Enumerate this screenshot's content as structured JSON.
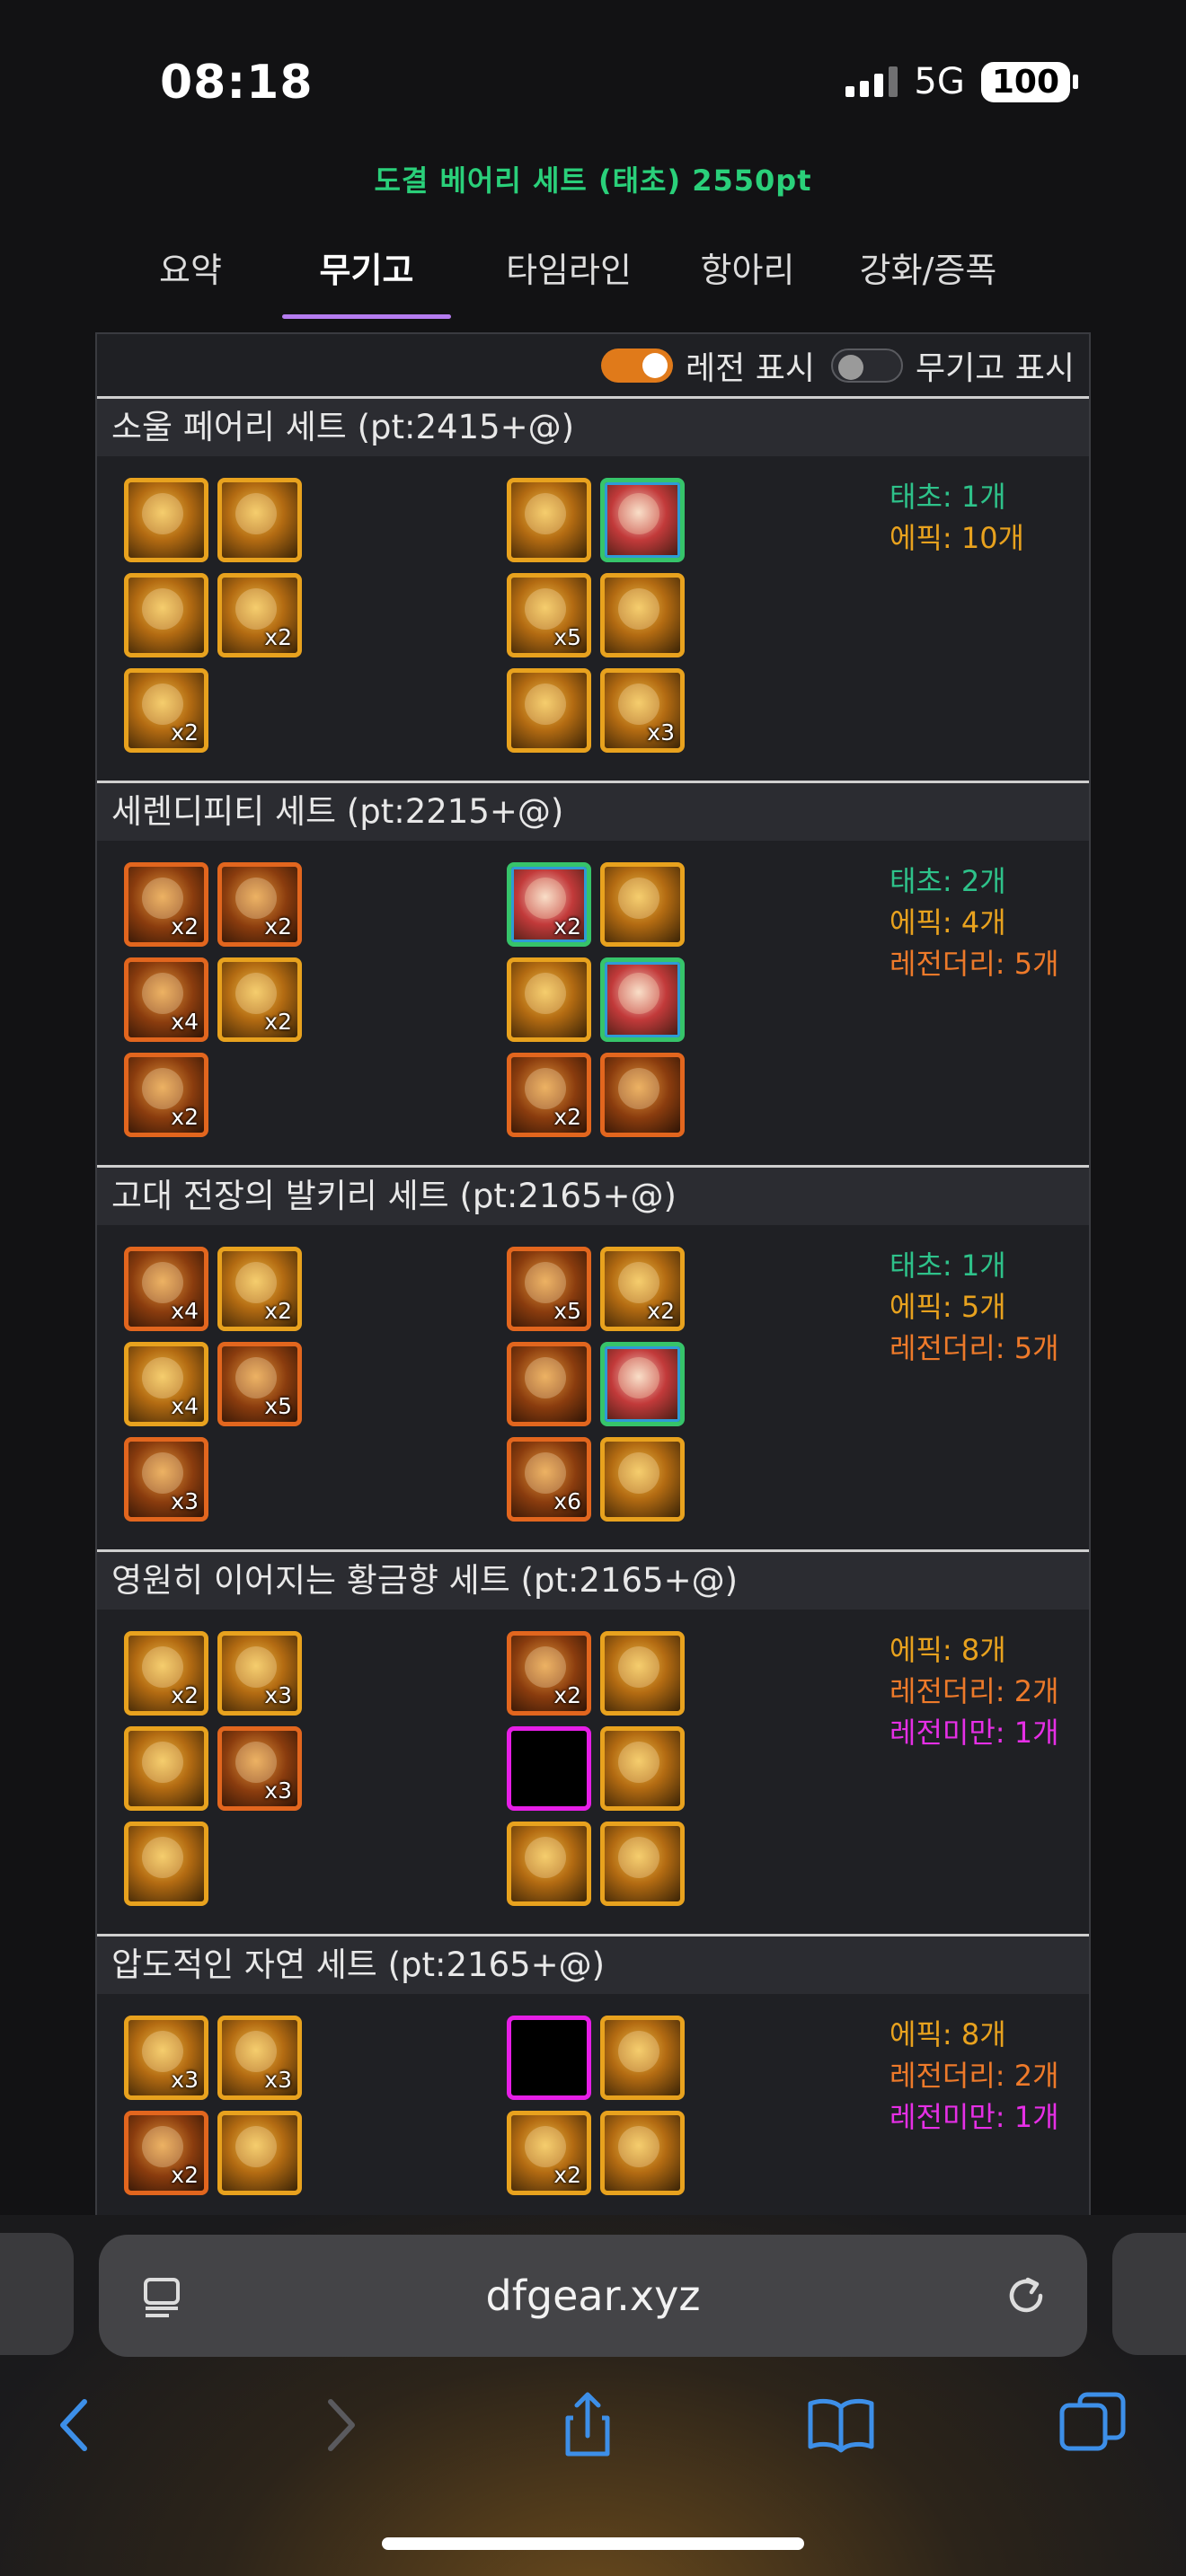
{
  "status_bar": {
    "time": "08:18",
    "network": "5G",
    "battery": "100"
  },
  "page_title": "도결 베어리 세트 (태초) 2550pt",
  "tabs": [
    {
      "label": "요약",
      "active": false
    },
    {
      "label": "무기고",
      "active": true
    },
    {
      "label": "타임라인",
      "active": false
    },
    {
      "label": "항아리",
      "active": false
    },
    {
      "label": "강화/증폭",
      "active": false
    }
  ],
  "toggles": {
    "legend_display": {
      "label": "레전 표시",
      "on": true
    },
    "armory_display": {
      "label": "무기고 표시",
      "on": false
    }
  },
  "colors": {
    "taecho": "#2ec28a",
    "epic": "#e8a21e",
    "legendary": "#ee7a2a",
    "under_legendary": "#e62fe6",
    "tab_underline": "#b57cf0",
    "title": "#2ad07a"
  },
  "sets": [
    {
      "title": "소울 페어리 세트 (pt:2415+@)",
      "left": [
        {
          "r": "ep",
          "n": ""
        },
        {
          "r": "ep",
          "n": ""
        },
        {
          "r": "ep",
          "n": ""
        },
        {
          "r": "ep",
          "n": "x2"
        },
        {
          "r": "ep",
          "n": "x2"
        }
      ],
      "right": [
        {
          "r": "ep",
          "n": ""
        },
        {
          "r": "tc",
          "n": ""
        },
        {
          "r": "ep",
          "n": "x5"
        },
        {
          "r": "ep",
          "n": ""
        },
        {
          "r": "ep",
          "n": ""
        },
        {
          "r": "ep",
          "n": "x3"
        }
      ],
      "stats": [
        {
          "cls": "c-tc",
          "text": "태초: 1개"
        },
        {
          "cls": "c-ep",
          "text": "에픽: 10개"
        }
      ]
    },
    {
      "title": "세렌디피티 세트 (pt:2215+@)",
      "left": [
        {
          "r": "lg",
          "n": "x2"
        },
        {
          "r": "lg",
          "n": "x2"
        },
        {
          "r": "lg",
          "n": "x4"
        },
        {
          "r": "ep",
          "n": "x2"
        },
        {
          "r": "lg",
          "n": "x2"
        }
      ],
      "right": [
        {
          "r": "tc",
          "n": "x2"
        },
        {
          "r": "ep",
          "n": ""
        },
        {
          "r": "ep",
          "n": ""
        },
        {
          "r": "tc",
          "n": ""
        },
        {
          "r": "lg",
          "n": "x2"
        },
        {
          "r": "lg",
          "n": ""
        }
      ],
      "stats": [
        {
          "cls": "c-tc",
          "text": "태초: 2개"
        },
        {
          "cls": "c-ep",
          "text": "에픽: 4개"
        },
        {
          "cls": "c-lg",
          "text": "레전더리: 5개"
        }
      ]
    },
    {
      "title": "고대 전장의 발키리 세트 (pt:2165+@)",
      "left": [
        {
          "r": "lg",
          "n": "x4"
        },
        {
          "r": "ep",
          "n": "x2"
        },
        {
          "r": "ep",
          "n": "x4"
        },
        {
          "r": "lg",
          "n": "x5"
        },
        {
          "r": "lg",
          "n": "x3"
        }
      ],
      "right": [
        {
          "r": "lg",
          "n": "x5"
        },
        {
          "r": "ep",
          "n": "x2"
        },
        {
          "r": "lg",
          "n": ""
        },
        {
          "r": "tc",
          "n": ""
        },
        {
          "r": "lg",
          "n": "x6"
        },
        {
          "r": "ep",
          "n": ""
        }
      ],
      "stats": [
        {
          "cls": "c-tc",
          "text": "태초: 1개"
        },
        {
          "cls": "c-ep",
          "text": "에픽: 5개"
        },
        {
          "cls": "c-lg",
          "text": "레전더리: 5개"
        }
      ]
    },
    {
      "title": "영원히 이어지는 황금향 세트 (pt:2165+@)",
      "left": [
        {
          "r": "ep",
          "n": "x2"
        },
        {
          "r": "ep",
          "n": "x3"
        },
        {
          "r": "ep",
          "n": ""
        },
        {
          "r": "lg",
          "n": "x3"
        },
        {
          "r": "ep",
          "n": ""
        }
      ],
      "right": [
        {
          "r": "lg",
          "n": "x2"
        },
        {
          "r": "ep",
          "n": ""
        },
        {
          "r": "um",
          "n": ""
        },
        {
          "r": "ep",
          "n": ""
        },
        {
          "r": "ep",
          "n": ""
        },
        {
          "r": "ep",
          "n": ""
        }
      ],
      "stats": [
        {
          "cls": "c-ep",
          "text": "에픽: 8개"
        },
        {
          "cls": "c-lg",
          "text": "레전더리: 2개"
        },
        {
          "cls": "c-um",
          "text": "레전미만: 1개"
        }
      ]
    },
    {
      "title": "압도적인 자연 세트 (pt:2165+@)",
      "left": [
        {
          "r": "ep",
          "n": "x3"
        },
        {
          "r": "ep",
          "n": "x3"
        },
        {
          "r": "lg",
          "n": "x2"
        },
        {
          "r": "ep",
          "n": ""
        }
      ],
      "right": [
        {
          "r": "um",
          "n": ""
        },
        {
          "r": "ep",
          "n": ""
        },
        {
          "r": "ep",
          "n": "x2"
        },
        {
          "r": "ep",
          "n": ""
        }
      ],
      "stats": [
        {
          "cls": "c-ep",
          "text": "에픽: 8개"
        },
        {
          "cls": "c-lg",
          "text": "레전더리: 2개"
        },
        {
          "cls": "c-um",
          "text": "레전미만: 1개"
        }
      ]
    }
  ],
  "browser": {
    "url": "dfgear.xyz"
  }
}
